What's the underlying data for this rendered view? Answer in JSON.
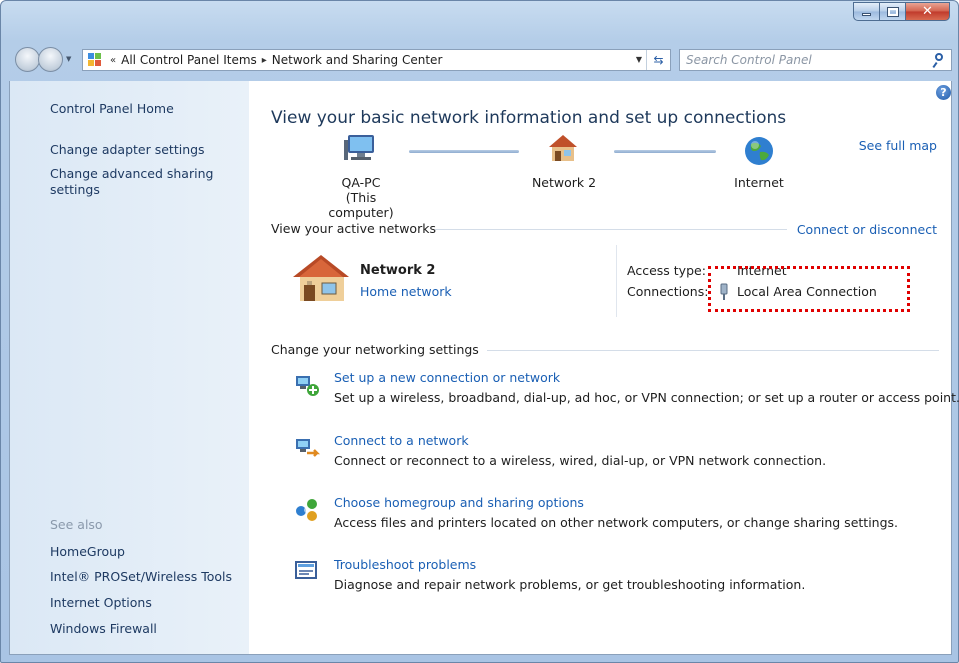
{
  "window": {
    "min_glyph": "minimize-icon",
    "max_glyph": "maximize-icon",
    "close_glyph": "✕"
  },
  "navbar": {
    "breadcrumb_overflow": "«",
    "crumbs": [
      "All Control Panel Items",
      "Network and Sharing Center"
    ],
    "separator": "▸",
    "search_placeholder": "Search Control Panel"
  },
  "sidebar": {
    "home": "Control Panel Home",
    "links": [
      "Change adapter settings",
      "Change advanced sharing settings"
    ],
    "see_also_label": "See also",
    "see_also": [
      "HomeGroup",
      "Intel® PROSet/Wireless Tools",
      "Internet Options",
      "Windows Firewall"
    ]
  },
  "main": {
    "help": "?",
    "title": "View your basic network information and set up connections",
    "see_full_map": "See full map",
    "map": {
      "computer_name": "QA-PC",
      "computer_sub": "(This computer)",
      "network": "Network  2",
      "internet": "Internet"
    },
    "active_networks": {
      "label": "View your active networks",
      "connect_link": "Connect or disconnect",
      "network_name": "Network  2",
      "network_type": "Home network",
      "access_type_label": "Access type:",
      "access_type_value": "Internet",
      "connections_label": "Connections:",
      "connections_value": "Local Area Connection"
    },
    "change_settings": {
      "label": "Change your networking settings",
      "tasks": [
        {
          "title": "Set up a new connection or network",
          "desc": "Set up a wireless, broadband, dial-up, ad hoc, or VPN connection; or set up a router or access point."
        },
        {
          "title": "Connect to a network",
          "desc": "Connect or reconnect to a wireless, wired, dial-up, or VPN network connection."
        },
        {
          "title": "Choose homegroup and sharing options",
          "desc": "Access files and printers located on other network computers, or change sharing settings."
        },
        {
          "title": "Troubleshoot problems",
          "desc": "Diagnose and repair network problems, or get troubleshooting information."
        }
      ]
    }
  },
  "colors": {
    "link": "#1a5fb4",
    "highlight": "#e00000",
    "sidebar_text": "#1e3a62",
    "title": "#1e395b"
  }
}
